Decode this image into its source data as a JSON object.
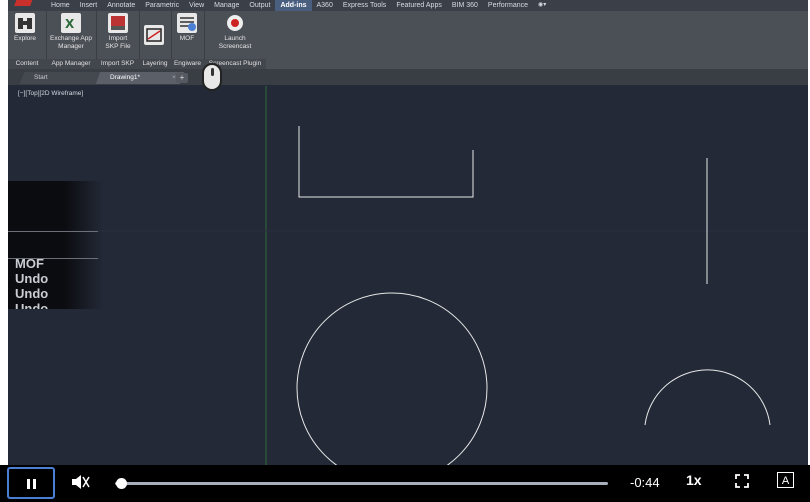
{
  "menubar": {
    "items": [
      "Home",
      "Insert",
      "Annotate",
      "Parametric",
      "View",
      "Manage",
      "Output",
      "Add-ins",
      "A360",
      "Express Tools",
      "Featured Apps",
      "BIM 360",
      "Performance"
    ],
    "active_index": 7
  },
  "ribbon": {
    "buttons": [
      {
        "label": "Explore",
        "icon": "binoculars-icon"
      },
      {
        "label": "Exchange App Manager",
        "icon": "exchange-icon"
      },
      {
        "label": "Import SKP File",
        "icon": "import-skp-icon"
      },
      {
        "label": "",
        "icon": "layering-icon"
      },
      {
        "label": "MOF",
        "icon": "mof-icon"
      },
      {
        "label": "Launch Screencast",
        "icon": "record-icon"
      }
    ],
    "groups": [
      "Content",
      "App Manager",
      "Import SKP",
      "Layering",
      "Engiware",
      "Screencast Plugin"
    ]
  },
  "tabs": {
    "start": "Start",
    "drawing": "Drawing1*",
    "close": "×",
    "new": "+"
  },
  "viewport": {
    "label": "[−][Top][2D Wireframe]"
  },
  "history": [
    "MOF",
    "Undo",
    "Undo",
    "Undo"
  ],
  "player": {
    "time": "-0:44",
    "rate": "1x",
    "cc": "A",
    "progress": 0.01
  },
  "colors": {
    "accent": "#4a7fd4",
    "background": "#232937",
    "ribbon": "#4b4f56"
  }
}
